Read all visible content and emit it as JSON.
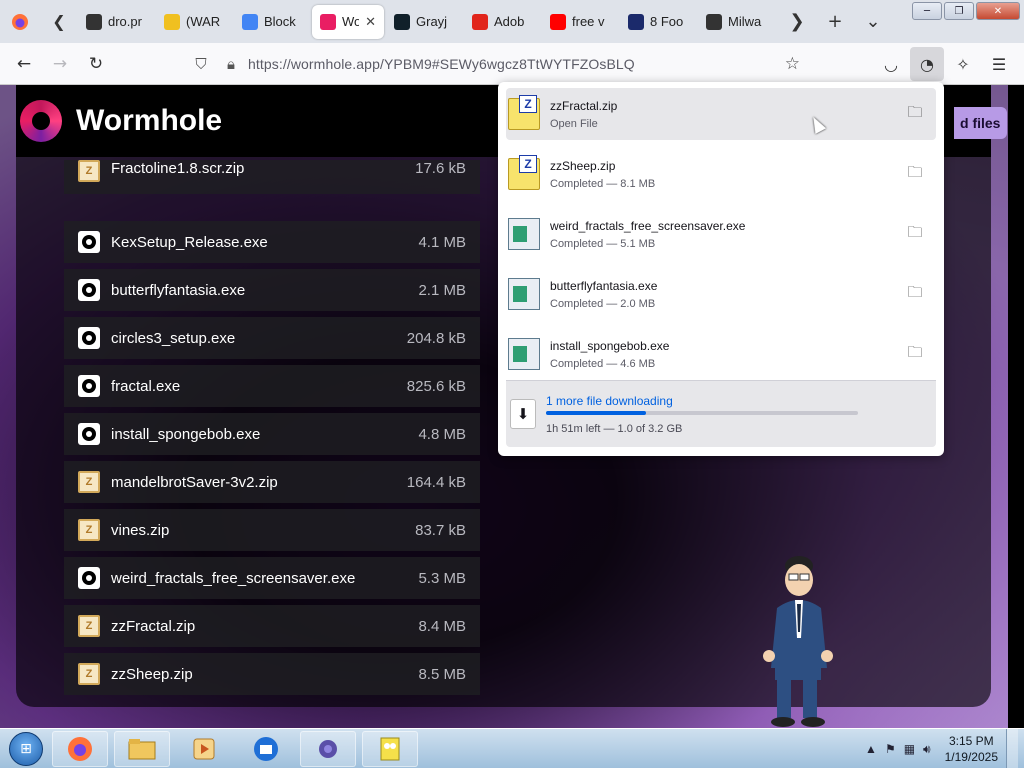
{
  "browser": {
    "tabs": [
      {
        "label": "dro.pr",
        "icon": "document-icon",
        "color": "#333333"
      },
      {
        "label": "(WAR",
        "icon": "link-icon",
        "color": "#f0c020"
      },
      {
        "label": "Block",
        "icon": "google-icon",
        "color": "#4285f4"
      },
      {
        "label": "Wo",
        "icon": "wormhole-icon",
        "color": "#e91e63",
        "active": true
      },
      {
        "label": "Grayj",
        "icon": "pen-icon",
        "color": "#10202a"
      },
      {
        "label": "Adob",
        "icon": "adobe-icon",
        "color": "#e1251b"
      },
      {
        "label": "free v",
        "icon": "youtube-icon",
        "color": "#ff0000"
      },
      {
        "label": "8 Foo",
        "icon": "news-icon",
        "color": "#1b2a6b"
      },
      {
        "label": "Milwa",
        "icon": "news-icon",
        "color": "#333333"
      }
    ],
    "url": "https://wormhole.app/YPBM9#SEWy6wgcz8TtWYTFZOsBLQ",
    "window_controls": {
      "minimize": "─",
      "maximize": "❐",
      "close": "✕"
    }
  },
  "page": {
    "brand": "Wormhole",
    "add_files_label": "d files",
    "partial_file": {
      "name": "Fractoline1.8.scr.zip",
      "size": "17.6 kB",
      "type": "zip"
    },
    "files": [
      {
        "name": "KexSetup_Release.exe",
        "size": "4.1 MB",
        "type": "exe"
      },
      {
        "name": "butterflyfantasia.exe",
        "size": "2.1 MB",
        "type": "exe"
      },
      {
        "name": "circles3_setup.exe",
        "size": "204.8 kB",
        "type": "exe"
      },
      {
        "name": "fractal.exe",
        "size": "825.6 kB",
        "type": "exe"
      },
      {
        "name": "install_spongebob.exe",
        "size": "4.8 MB",
        "type": "exe"
      },
      {
        "name": "mandelbrotSaver-3v2.zip",
        "size": "164.4 kB",
        "type": "zip"
      },
      {
        "name": "vines.zip",
        "size": "83.7 kB",
        "type": "zip"
      },
      {
        "name": "weird_fractals_free_screensaver.exe",
        "size": "5.3 MB",
        "type": "exe"
      },
      {
        "name": "zzFractal.zip",
        "size": "8.4 MB",
        "type": "zip"
      },
      {
        "name": "zzSheep.zip",
        "size": "8.5 MB",
        "type": "zip"
      }
    ]
  },
  "downloads": {
    "items": [
      {
        "name": "zzFractal.zip",
        "status": "Open File",
        "type": "zip",
        "hover": true
      },
      {
        "name": "zzSheep.zip",
        "status": "Completed — 8.1 MB",
        "type": "zip"
      },
      {
        "name": "weird_fractals_free_screensaver.exe",
        "status": "Completed — 5.1 MB",
        "type": "exe"
      },
      {
        "name": "butterflyfantasia.exe",
        "status": "Completed — 2.0 MB",
        "type": "exe"
      },
      {
        "name": "install_spongebob.exe",
        "status": "Completed — 4.6 MB",
        "type": "exe"
      }
    ],
    "more": {
      "title": "1 more file downloading",
      "progress": 0.32,
      "meta": "1h 51m left — 1.0 of 3.2 GB"
    }
  },
  "taskbar": {
    "apps": [
      "firefox-icon",
      "file-explorer-icon",
      "media-player-icon",
      "thunderbird-icon",
      "screensaver-app-icon",
      "spongebob-icon"
    ],
    "clock_time": "3:15 PM",
    "clock_date": "1/19/2025"
  }
}
